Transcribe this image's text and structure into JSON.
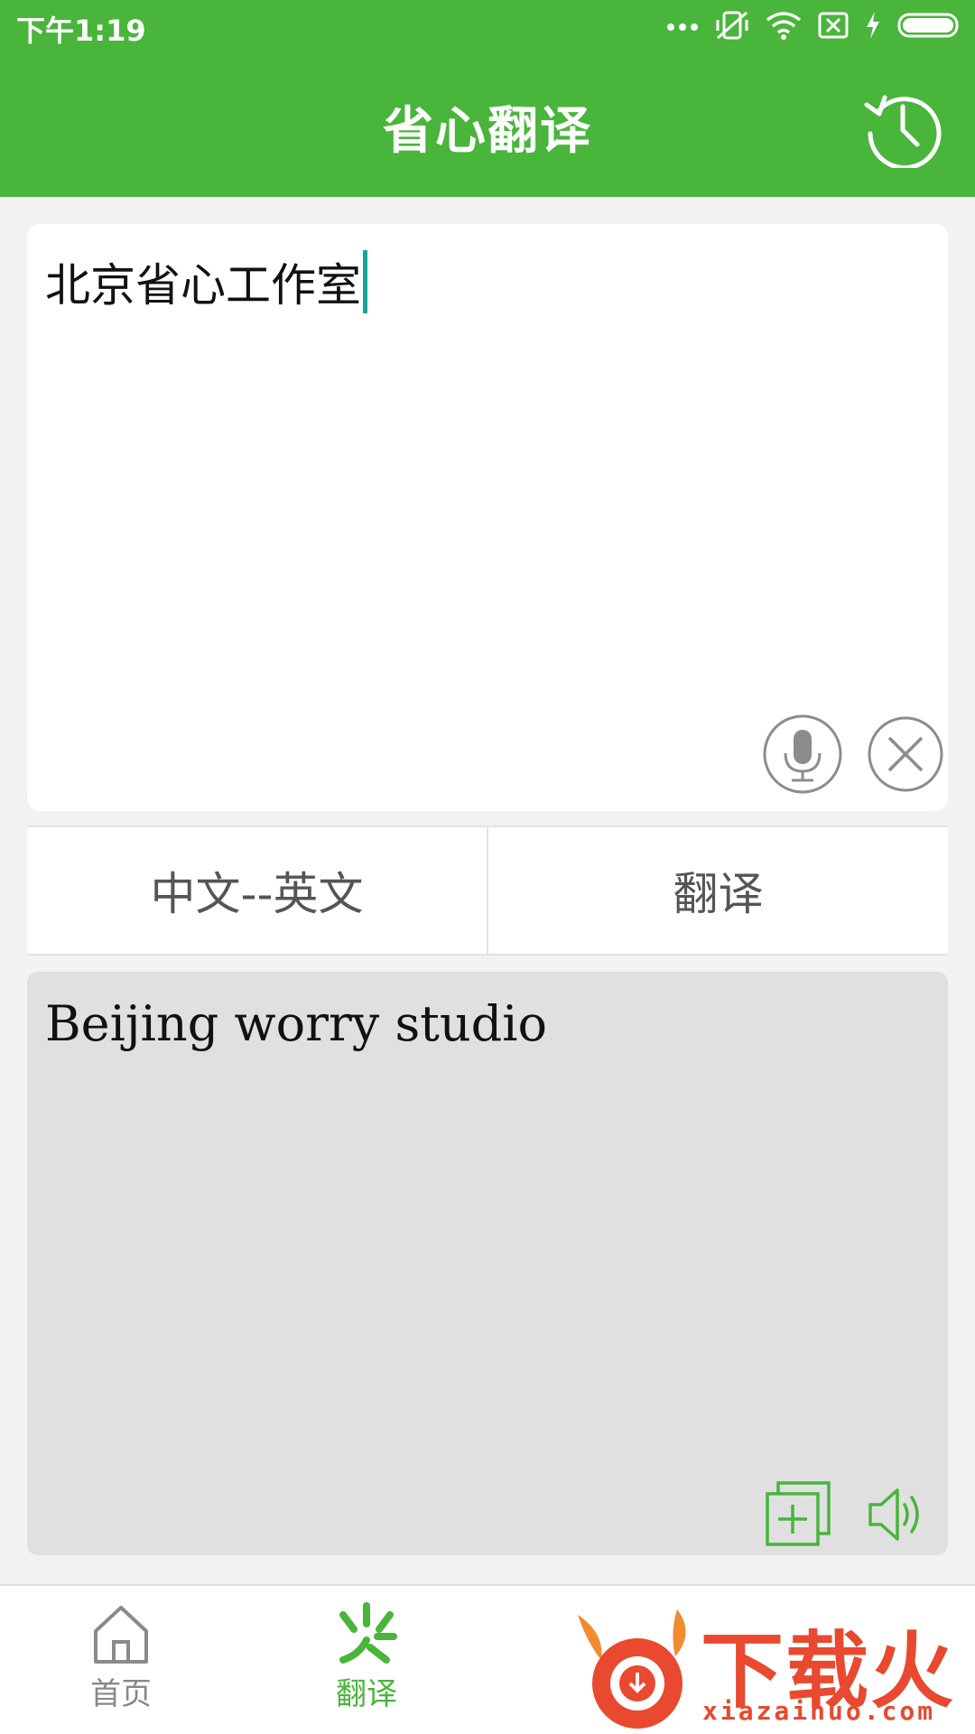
{
  "status_bar": {
    "time": "下午1:19"
  },
  "header": {
    "title": "省心翻译"
  },
  "input": {
    "text": "北京省心工作室"
  },
  "actions": {
    "language_pair": "中文--英文",
    "translate_label": "翻译"
  },
  "output": {
    "text": "Beijing worry studio"
  },
  "nav": {
    "items": [
      {
        "label": "首页",
        "icon": "home-icon"
      },
      {
        "label": "翻译",
        "icon": "translate-icon"
      }
    ]
  },
  "watermark": {
    "brand": "下载火",
    "url": "xiazaihuo.com"
  },
  "colors": {
    "brand": "#49b53b",
    "caret": "#1aa59a",
    "watermark": "#e8492f"
  }
}
